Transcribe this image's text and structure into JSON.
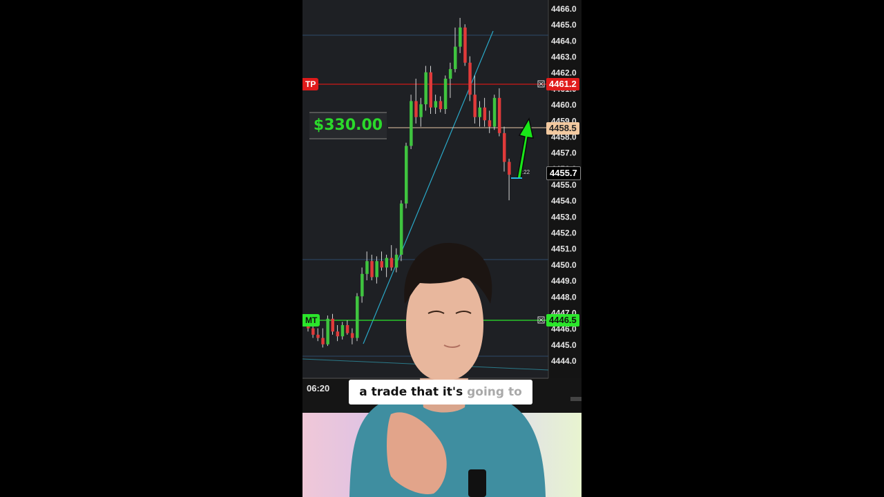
{
  "chart": {
    "price_ticks": [
      "4466.0",
      "4465.0",
      "4464.0",
      "4463.0",
      "4462.0",
      "4461.0",
      "4460.0",
      "4459.0",
      "4458.0",
      "4457.0",
      "4456.0",
      "4455.0",
      "4454.0",
      "4453.0",
      "4452.0",
      "4451.0",
      "4450.0",
      "4449.0",
      "4448.0",
      "4447.0",
      "4446.0",
      "4445.0",
      "4444.0"
    ],
    "take_profit": {
      "tag": "TP",
      "price": "4461.2",
      "color": "#e01b1b"
    },
    "entry": {
      "price": "4458.5",
      "color": "#f2c9a0"
    },
    "current": {
      "price": "4455.7"
    },
    "stop": {
      "tag": "MT",
      "price": "4446.5",
      "color": "#2be62b"
    },
    "pnl": "$330.00",
    "time_label": "06:20",
    "timer_text": ":22"
  },
  "caption": {
    "spoken": "a trade that it's",
    "upcoming": "going to"
  },
  "colors": {
    "bull": "#3fc43f",
    "bear": "#e03a3a",
    "panel": "#1d1f23",
    "axis": "#141414",
    "trendline": "#2aa9c9"
  },
  "icons": [
    "close-order-icon",
    "green-arrow-icon"
  ]
}
